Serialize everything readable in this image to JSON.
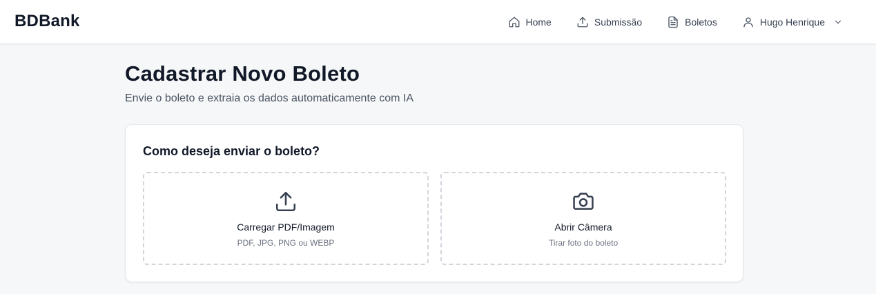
{
  "header": {
    "brand": "BDBank",
    "nav": [
      {
        "label": "Home",
        "icon": "home-icon"
      },
      {
        "label": "Submissão",
        "icon": "upload-icon"
      },
      {
        "label": "Boletos",
        "icon": "document-icon"
      }
    ],
    "user": {
      "name": "Hugo Henrique",
      "icon": "user-icon",
      "menu_icon": "chevron-down-icon"
    }
  },
  "page": {
    "title": "Cadastrar Novo Boleto",
    "subtitle": "Envie o boleto e extraia os dados automaticamente com IA"
  },
  "upload_card": {
    "title": "Como deseja enviar o boleto?",
    "options": [
      {
        "label": "Carregar PDF/Imagem",
        "hint": "PDF, JPG, PNG ou WEBP",
        "icon": "upload-icon"
      },
      {
        "label": "Abrir Câmera",
        "hint": "Tirar foto do boleto",
        "icon": "camera-icon"
      }
    ]
  },
  "colors": {
    "background": "#f6f7f8",
    "card": "#ffffff",
    "border": "#e5e7eb",
    "dashed_border": "#d1d5db",
    "text_primary": "#111827",
    "text_secondary": "#4b5563"
  }
}
